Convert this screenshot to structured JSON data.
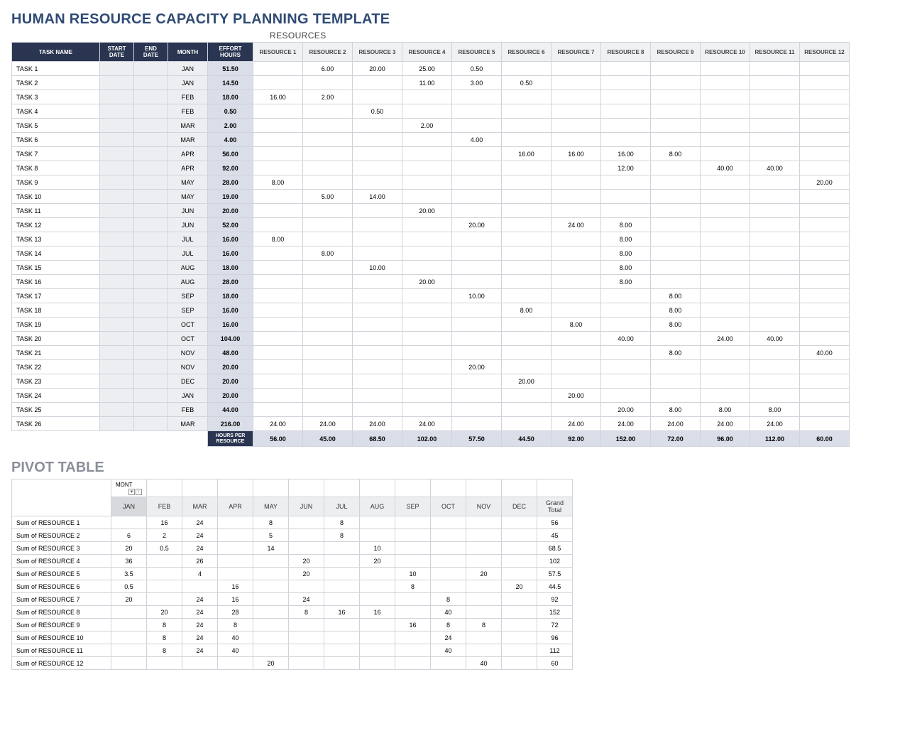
{
  "title": "HUMAN RESOURCE CAPACITY PLANNING TEMPLATE",
  "resources_label": "RESOURCES",
  "main_headers": {
    "task_name": "TASK NAME",
    "start_date": "START DATE",
    "end_date": "END DATE",
    "month": "MONTH",
    "effort_hours": "EFFORT HOURS",
    "resources": [
      "RESOURCE 1",
      "RESOURCE 2",
      "RESOURCE 3",
      "RESOURCE 4",
      "RESOURCE 5",
      "RESOURCE 6",
      "RESOURCE 7",
      "RESOURCE 8",
      "RESOURCE 9",
      "RESOURCE 10",
      "RESOURCE 11",
      "RESOURCE 12"
    ]
  },
  "tasks": [
    {
      "name": "TASK 1",
      "start": "",
      "end": "",
      "month": "JAN",
      "effort": "51.50",
      "r": [
        "",
        "6.00",
        "20.00",
        "25.00",
        "0.50",
        "",
        "",
        "",
        "",
        "",
        "",
        ""
      ]
    },
    {
      "name": "TASK 2",
      "start": "",
      "end": "",
      "month": "JAN",
      "effort": "14.50",
      "r": [
        "",
        "",
        "",
        "11.00",
        "3.00",
        "0.50",
        "",
        "",
        "",
        "",
        "",
        ""
      ]
    },
    {
      "name": "TASK 3",
      "start": "",
      "end": "",
      "month": "FEB",
      "effort": "18.00",
      "r": [
        "16.00",
        "2.00",
        "",
        "",
        "",
        "",
        "",
        "",
        "",
        "",
        "",
        ""
      ]
    },
    {
      "name": "TASK 4",
      "start": "",
      "end": "",
      "month": "FEB",
      "effort": "0.50",
      "r": [
        "",
        "",
        "0.50",
        "",
        "",
        "",
        "",
        "",
        "",
        "",
        "",
        ""
      ]
    },
    {
      "name": "TASK 5",
      "start": "",
      "end": "",
      "month": "MAR",
      "effort": "2.00",
      "r": [
        "",
        "",
        "",
        "2.00",
        "",
        "",
        "",
        "",
        "",
        "",
        "",
        ""
      ]
    },
    {
      "name": "TASK 6",
      "start": "",
      "end": "",
      "month": "MAR",
      "effort": "4.00",
      "r": [
        "",
        "",
        "",
        "",
        "4.00",
        "",
        "",
        "",
        "",
        "",
        "",
        ""
      ]
    },
    {
      "name": "TASK 7",
      "start": "",
      "end": "",
      "month": "APR",
      "effort": "56.00",
      "r": [
        "",
        "",
        "",
        "",
        "",
        "16.00",
        "16.00",
        "16.00",
        "8.00",
        "",
        "",
        ""
      ]
    },
    {
      "name": "TASK 8",
      "start": "",
      "end": "",
      "month": "APR",
      "effort": "92.00",
      "r": [
        "",
        "",
        "",
        "",
        "",
        "",
        "",
        "12.00",
        "",
        "40.00",
        "40.00",
        ""
      ]
    },
    {
      "name": "TASK 9",
      "start": "",
      "end": "",
      "month": "MAY",
      "effort": "28.00",
      "r": [
        "8.00",
        "",
        "",
        "",
        "",
        "",
        "",
        "",
        "",
        "",
        "",
        "20.00"
      ]
    },
    {
      "name": "TASK 10",
      "start": "",
      "end": "",
      "month": "MAY",
      "effort": "19.00",
      "r": [
        "",
        "5.00",
        "14.00",
        "",
        "",
        "",
        "",
        "",
        "",
        "",
        "",
        ""
      ]
    },
    {
      "name": "TASK 11",
      "start": "",
      "end": "",
      "month": "JUN",
      "effort": "20.00",
      "r": [
        "",
        "",
        "",
        "20.00",
        "",
        "",
        "",
        "",
        "",
        "",
        "",
        ""
      ]
    },
    {
      "name": "TASK 12",
      "start": "",
      "end": "",
      "month": "JUN",
      "effort": "52.00",
      "r": [
        "",
        "",
        "",
        "",
        "20.00",
        "",
        "24.00",
        "8.00",
        "",
        "",
        "",
        ""
      ]
    },
    {
      "name": "TASK 13",
      "start": "",
      "end": "",
      "month": "JUL",
      "effort": "16.00",
      "r": [
        "8.00",
        "",
        "",
        "",
        "",
        "",
        "",
        "8.00",
        "",
        "",
        "",
        ""
      ]
    },
    {
      "name": "TASK 14",
      "start": "",
      "end": "",
      "month": "JUL",
      "effort": "16.00",
      "r": [
        "",
        "8.00",
        "",
        "",
        "",
        "",
        "",
        "8.00",
        "",
        "",
        "",
        ""
      ]
    },
    {
      "name": "TASK 15",
      "start": "",
      "end": "",
      "month": "AUG",
      "effort": "18.00",
      "r": [
        "",
        "",
        "10.00",
        "",
        "",
        "",
        "",
        "8.00",
        "",
        "",
        "",
        ""
      ]
    },
    {
      "name": "TASK 16",
      "start": "",
      "end": "",
      "month": "AUG",
      "effort": "28.00",
      "r": [
        "",
        "",
        "",
        "20.00",
        "",
        "",
        "",
        "8.00",
        "",
        "",
        "",
        ""
      ]
    },
    {
      "name": "TASK 17",
      "start": "",
      "end": "",
      "month": "SEP",
      "effort": "18.00",
      "r": [
        "",
        "",
        "",
        "",
        "10.00",
        "",
        "",
        "",
        "8.00",
        "",
        "",
        ""
      ]
    },
    {
      "name": "TASK 18",
      "start": "",
      "end": "",
      "month": "SEP",
      "effort": "16.00",
      "r": [
        "",
        "",
        "",
        "",
        "",
        "8.00",
        "",
        "",
        "8.00",
        "",
        "",
        ""
      ]
    },
    {
      "name": "TASK 19",
      "start": "",
      "end": "",
      "month": "OCT",
      "effort": "16.00",
      "r": [
        "",
        "",
        "",
        "",
        "",
        "",
        "8.00",
        "",
        "8.00",
        "",
        "",
        ""
      ]
    },
    {
      "name": "TASK 20",
      "start": "",
      "end": "",
      "month": "OCT",
      "effort": "104.00",
      "r": [
        "",
        "",
        "",
        "",
        "",
        "",
        "",
        "40.00",
        "",
        "24.00",
        "40.00",
        ""
      ]
    },
    {
      "name": "TASK 21",
      "start": "",
      "end": "",
      "month": "NOV",
      "effort": "48.00",
      "r": [
        "",
        "",
        "",
        "",
        "",
        "",
        "",
        "",
        "8.00",
        "",
        "",
        "40.00"
      ]
    },
    {
      "name": "TASK 22",
      "start": "",
      "end": "",
      "month": "NOV",
      "effort": "20.00",
      "r": [
        "",
        "",
        "",
        "",
        "20.00",
        "",
        "",
        "",
        "",
        "",
        "",
        ""
      ]
    },
    {
      "name": "TASK 23",
      "start": "",
      "end": "",
      "month": "DEC",
      "effort": "20.00",
      "r": [
        "",
        "",
        "",
        "",
        "",
        "20.00",
        "",
        "",
        "",
        "",
        "",
        ""
      ]
    },
    {
      "name": "TASK 24",
      "start": "",
      "end": "",
      "month": "JAN",
      "effort": "20.00",
      "r": [
        "",
        "",
        "",
        "",
        "",
        "",
        "20.00",
        "",
        "",
        "",
        "",
        ""
      ]
    },
    {
      "name": "TASK 25",
      "start": "",
      "end": "",
      "month": "FEB",
      "effort": "44.00",
      "r": [
        "",
        "",
        "",
        "",
        "",
        "",
        "",
        "20.00",
        "8.00",
        "8.00",
        "8.00",
        ""
      ]
    },
    {
      "name": "TASK 26",
      "start": "",
      "end": "",
      "month": "MAR",
      "effort": "216.00",
      "r": [
        "24.00",
        "24.00",
        "24.00",
        "24.00",
        "",
        "",
        "24.00",
        "24.00",
        "24.00",
        "24.00",
        "24.00",
        ""
      ]
    }
  ],
  "footer_label": "HOURS PER RESOURCE",
  "footer_vals": [
    "56.00",
    "45.00",
    "68.50",
    "102.00",
    "57.50",
    "44.50",
    "92.00",
    "152.00",
    "72.00",
    "96.00",
    "112.00",
    "60.00"
  ],
  "pivot_title": "PIVOT TABLE",
  "pivot": {
    "month_sort_label": "MONT",
    "months": [
      "JAN",
      "FEB",
      "MAR",
      "APR",
      "MAY",
      "JUN",
      "JUL",
      "AUG",
      "SEP",
      "OCT",
      "NOV",
      "DEC"
    ],
    "grand_total_label": "Grand Total",
    "rows": [
      {
        "label": "Sum of RESOURCE 1",
        "vals": [
          "",
          "16",
          "24",
          "",
          "8",
          "",
          "8",
          "",
          "",
          "",
          "",
          ""
        ],
        "total": "56"
      },
      {
        "label": "Sum of RESOURCE 2",
        "vals": [
          "6",
          "2",
          "24",
          "",
          "5",
          "",
          "8",
          "",
          "",
          "",
          "",
          ""
        ],
        "total": "45"
      },
      {
        "label": "Sum of RESOURCE 3",
        "vals": [
          "20",
          "0.5",
          "24",
          "",
          "14",
          "",
          "",
          "10",
          "",
          "",
          "",
          ""
        ],
        "total": "68.5"
      },
      {
        "label": "Sum of RESOURCE 4",
        "vals": [
          "36",
          "",
          "26",
          "",
          "",
          "20",
          "",
          "20",
          "",
          "",
          "",
          ""
        ],
        "total": "102"
      },
      {
        "label": "Sum of RESOURCE 5",
        "vals": [
          "3.5",
          "",
          "4",
          "",
          "",
          "20",
          "",
          "",
          "10",
          "",
          "20",
          ""
        ],
        "total": "57.5"
      },
      {
        "label": "Sum of RESOURCE 6",
        "vals": [
          "0.5",
          "",
          "",
          "16",
          "",
          "",
          "",
          "",
          "8",
          "",
          "",
          "20"
        ],
        "total": "44.5"
      },
      {
        "label": "Sum of RESOURCE 7",
        "vals": [
          "20",
          "",
          "24",
          "16",
          "",
          "24",
          "",
          "",
          "",
          "8",
          "",
          ""
        ],
        "total": "92"
      },
      {
        "label": "Sum of RESOURCE 8",
        "vals": [
          "",
          "20",
          "24",
          "28",
          "",
          "8",
          "16",
          "16",
          "",
          "40",
          "",
          ""
        ],
        "total": "152"
      },
      {
        "label": "Sum of RESOURCE 9",
        "vals": [
          "",
          "8",
          "24",
          "8",
          "",
          "",
          "",
          "",
          "16",
          "8",
          "8",
          ""
        ],
        "total": "72"
      },
      {
        "label": "Sum of RESOURCE 10",
        "vals": [
          "",
          "8",
          "24",
          "40",
          "",
          "",
          "",
          "",
          "",
          "24",
          "",
          ""
        ],
        "total": "96"
      },
      {
        "label": "Sum of RESOURCE 11",
        "vals": [
          "",
          "8",
          "24",
          "40",
          "",
          "",
          "",
          "",
          "",
          "40",
          "",
          ""
        ],
        "total": "112"
      },
      {
        "label": "Sum of RESOURCE 12",
        "vals": [
          "",
          "",
          "",
          "",
          "20",
          "",
          "",
          "",
          "",
          "",
          "40",
          ""
        ],
        "total": "60"
      }
    ]
  },
  "chart_data": {
    "type": "table",
    "title": "Human Resource Capacity Planning",
    "resources_totals": {
      "RESOURCE 1": 56,
      "RESOURCE 2": 45,
      "RESOURCE 3": 68.5,
      "RESOURCE 4": 102,
      "RESOURCE 5": 57.5,
      "RESOURCE 6": 44.5,
      "RESOURCE 7": 92,
      "RESOURCE 8": 152,
      "RESOURCE 9": 72,
      "RESOURCE 10": 96,
      "RESOURCE 11": 112,
      "RESOURCE 12": 60
    }
  }
}
